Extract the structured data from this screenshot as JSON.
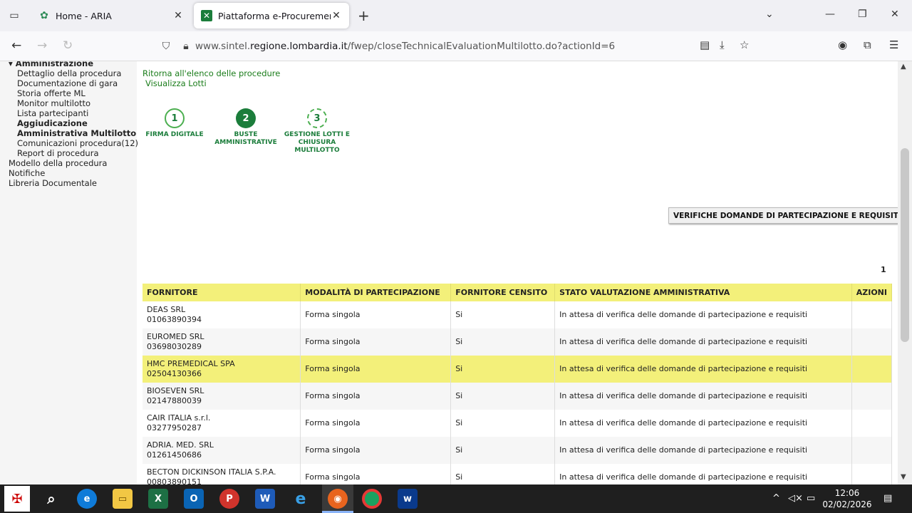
{
  "browser": {
    "tabs": [
      {
        "title": "Home - ARIA",
        "favicon": "aria-icon"
      },
      {
        "title": "Piattaforma e-Procurement Sintel",
        "favicon": "sintel-icon",
        "active": true
      }
    ],
    "url_prefix": "www.sintel.",
    "url_domain": "regione.lombardia.it",
    "url_path": "/fwep/closeTechnicalEvaluationMultilotto.do?actionId=6"
  },
  "sidebar": {
    "items": [
      "Amministrazione",
      "Dettaglio della procedura",
      "Documentazione di gara",
      "Storia offerte ML",
      "Monitor multilotto",
      "Lista partecipanti",
      "Aggiudicazione",
      "Amministrativa Multilotto",
      "Comunicazioni procedura(12)",
      "Report di procedura",
      "Modello della procedura",
      "Notifiche",
      "Libreria Documentale"
    ]
  },
  "links": {
    "back": "Ritorna all'elenco delle procedure",
    "lots": "Visualizza Lotti"
  },
  "steps": [
    {
      "num": "1",
      "label1": "FIRMA DIGITALE",
      "label2": "",
      "label3": "",
      "state": "done"
    },
    {
      "num": "2",
      "label1": "BUSTE",
      "label2": "AMMINISTRATIVE",
      "label3": "",
      "state": "active"
    },
    {
      "num": "3",
      "label1": "GESTIONE LOTTI E",
      "label2": "CHIUSURA",
      "label3": "MULTILOTTO",
      "state": "pending"
    }
  ],
  "verify_button": "VERIFICHE DOMANDE DI PARTECIPAZIONE E REQUISITI",
  "page_number": "1",
  "table": {
    "headers": [
      "FORNITORE",
      "MODALITÀ DI PARTECIPAZIONE",
      "FORNITORE CENSITO",
      "STATO VALUTAZIONE AMMINISTRATIVA",
      "AZIONI"
    ],
    "rows": [
      {
        "name": "DEAS SRL",
        "code": "01063890394",
        "mode": "Forma singola",
        "censito": "Si",
        "stato": "In attesa di verifica delle domande di partecipazione e requisiti"
      },
      {
        "name": "EUROMED SRL",
        "code": "03698030289",
        "mode": "Forma singola",
        "censito": "Si",
        "stato": "In attesa di verifica delle domande di partecipazione e requisiti"
      },
      {
        "name": "HMC PREMEDICAL SPA",
        "code": "02504130366",
        "mode": "Forma singola",
        "censito": "Si",
        "stato": "In attesa di verifica delle domande di partecipazione e requisiti"
      },
      {
        "name": "BIOSEVEN SRL",
        "code": "02147880039",
        "mode": "Forma singola",
        "censito": "Si",
        "stato": "In attesa di verifica delle domande di partecipazione e requisiti"
      },
      {
        "name": "CAIR ITALIA s.r.l.",
        "code": "03277950287",
        "mode": "Forma singola",
        "censito": "Si",
        "stato": "In attesa di verifica delle domande di partecipazione e requisiti"
      },
      {
        "name": "ADRIA. MED. SRL",
        "code": "01261450686",
        "mode": "Forma singola",
        "censito": "Si",
        "stato": "In attesa di verifica delle domande di partecipazione e requisiti"
      },
      {
        "name": "BECTON DICKINSON ITALIA S.P.A.",
        "code": "00803890151",
        "mode": "Forma singola",
        "censito": "Si",
        "stato": "In attesa di verifica delle domande di partecipazione e requisiti"
      }
    ]
  },
  "taskbar": {
    "time": "12:06",
    "date": "02/02/2026"
  },
  "colors": {
    "accent_green": "#1b7d3b",
    "header_yellow": "#f3f07a"
  }
}
